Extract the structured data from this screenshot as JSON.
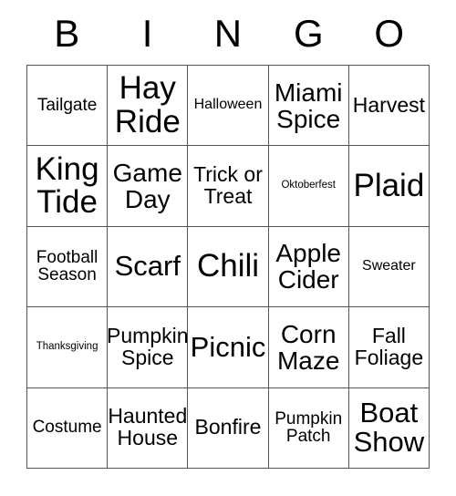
{
  "card": {
    "title": "BINGO",
    "header_letters": [
      "B",
      "I",
      "N",
      "G",
      "O"
    ],
    "grid_columns": 5,
    "grid_rows": 5,
    "border_color": "#555555",
    "text_color": "#000000",
    "background_color": "#ffffff",
    "rows": [
      [
        {
          "label": "Tailgate",
          "size": "sm"
        },
        {
          "label": "Hay\nRide",
          "size": "xxl"
        },
        {
          "label": "Halloween",
          "size": "xs"
        },
        {
          "label": "Miami\nSpice",
          "size": "lg"
        },
        {
          "label": "Harvest",
          "size": "md"
        }
      ],
      [
        {
          "label": "King\nTide",
          "size": "xxl"
        },
        {
          "label": "Game\nDay",
          "size": "lg"
        },
        {
          "label": "Trick or\nTreat",
          "size": "md"
        },
        {
          "label": "Oktoberfest",
          "size": "xxs"
        },
        {
          "label": "Plaid",
          "size": "xxl"
        }
      ],
      [
        {
          "label": "Football\nSeason",
          "size": "sm"
        },
        {
          "label": "Scarf",
          "size": "xl"
        },
        {
          "label": "Chili",
          "size": "xxl"
        },
        {
          "label": "Apple\nCider",
          "size": "lg"
        },
        {
          "label": "Sweater",
          "size": "xs"
        }
      ],
      [
        {
          "label": "Thanksgiving",
          "size": "xxs"
        },
        {
          "label": "Pumpkin\nSpice",
          "size": "md"
        },
        {
          "label": "Picnic",
          "size": "xl"
        },
        {
          "label": "Corn\nMaze",
          "size": "lg"
        },
        {
          "label": "Fall\nFoliage",
          "size": "md"
        }
      ],
      [
        {
          "label": "Costume",
          "size": "sm"
        },
        {
          "label": "Haunted\nHouse",
          "size": "md"
        },
        {
          "label": "Bonfire",
          "size": "md"
        },
        {
          "label": "Pumpkin\nPatch",
          "size": "sm"
        },
        {
          "label": "Boat\nShow",
          "size": "xl"
        }
      ]
    ]
  }
}
